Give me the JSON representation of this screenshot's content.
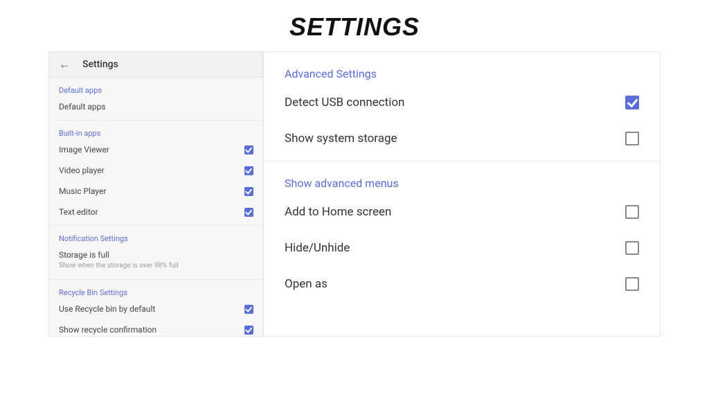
{
  "page_heading": "SETTINGS",
  "left": {
    "header_title": "Settings",
    "sections": [
      {
        "title": "Default apps",
        "items": [
          {
            "label": "Default apps",
            "checkbox": false
          }
        ]
      },
      {
        "title": "Built-in apps",
        "items": [
          {
            "label": "Image Viewer",
            "checkbox": true,
            "checked": true
          },
          {
            "label": "Video player",
            "checkbox": true,
            "checked": true
          },
          {
            "label": "Music Player",
            "checkbox": true,
            "checked": true
          },
          {
            "label": "Text editor",
            "checkbox": true,
            "checked": true
          }
        ]
      },
      {
        "title": "Notification Settings",
        "items": [
          {
            "label": "Storage is full",
            "sub": "Show when the storage is over 98% full",
            "checkbox": false
          }
        ]
      },
      {
        "title": "Recycle Bin Settings",
        "items": [
          {
            "label": "Use Recycle bin by default",
            "checkbox": true,
            "checked": true
          },
          {
            "label": "Show recycle confirmation",
            "checkbox": true,
            "checked": true
          }
        ]
      }
    ]
  },
  "right": {
    "sections": [
      {
        "title": "Advanced Settings",
        "items": [
          {
            "label": "Detect USB connection",
            "checked": true
          },
          {
            "label": "Show system storage",
            "checked": false
          }
        ]
      },
      {
        "title": "Show advanced menus",
        "items": [
          {
            "label": "Add to Home screen",
            "checked": false
          },
          {
            "label": "Hide/Unhide",
            "checked": false
          },
          {
            "label": "Open as",
            "checked": false
          }
        ]
      }
    ]
  }
}
